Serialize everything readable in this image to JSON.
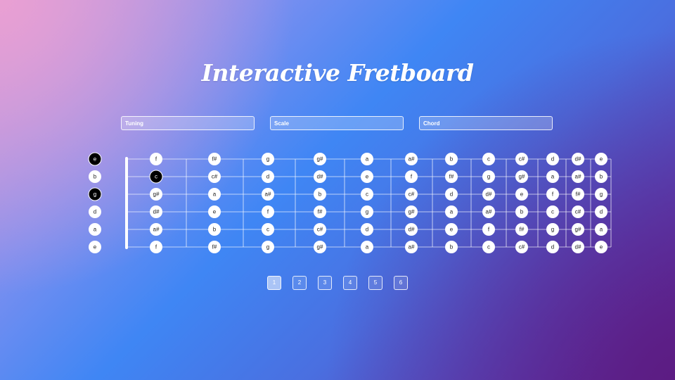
{
  "title": "Interactive Fretboard",
  "selects": {
    "tuning": "Tuning",
    "scale": "Scale",
    "chord": "Chord"
  },
  "open_strings": [
    {
      "note": "e",
      "highlighted": true
    },
    {
      "note": "b",
      "highlighted": false
    },
    {
      "note": "g",
      "highlighted": true
    },
    {
      "note": "d",
      "highlighted": false
    },
    {
      "note": "a",
      "highlighted": false
    },
    {
      "note": "e",
      "highlighted": false
    }
  ],
  "fret_notes": [
    [
      "f",
      "f#",
      "g",
      "g#",
      "a",
      "a#",
      "b",
      "c",
      "c#",
      "d",
      "d#",
      "e"
    ],
    [
      "c",
      "c#",
      "d",
      "d#",
      "e",
      "f",
      "f#",
      "g",
      "g#",
      "a",
      "a#",
      "b"
    ],
    [
      "g#",
      "a",
      "a#",
      "b",
      "c",
      "c#",
      "d",
      "d#",
      "e",
      "f",
      "f#",
      "g"
    ],
    [
      "d#",
      "e",
      "f",
      "f#",
      "g",
      "g#",
      "a",
      "a#",
      "b",
      "c",
      "c#",
      "d"
    ],
    [
      "a#",
      "b",
      "c",
      "c#",
      "d",
      "d#",
      "e",
      "f",
      "f#",
      "g",
      "g#",
      "a"
    ],
    [
      "f",
      "f#",
      "g",
      "g#",
      "a",
      "a#",
      "b",
      "c",
      "c#",
      "d",
      "d#",
      "e"
    ]
  ],
  "highlighted_frets": [
    [
      1,
      0
    ]
  ],
  "pages": [
    "1",
    "2",
    "3",
    "4",
    "5",
    "6"
  ],
  "active_page": 0,
  "colors": {
    "note_fill": "#ffffff",
    "highlight_fill": "#000000",
    "string_line": "#ffffff"
  }
}
